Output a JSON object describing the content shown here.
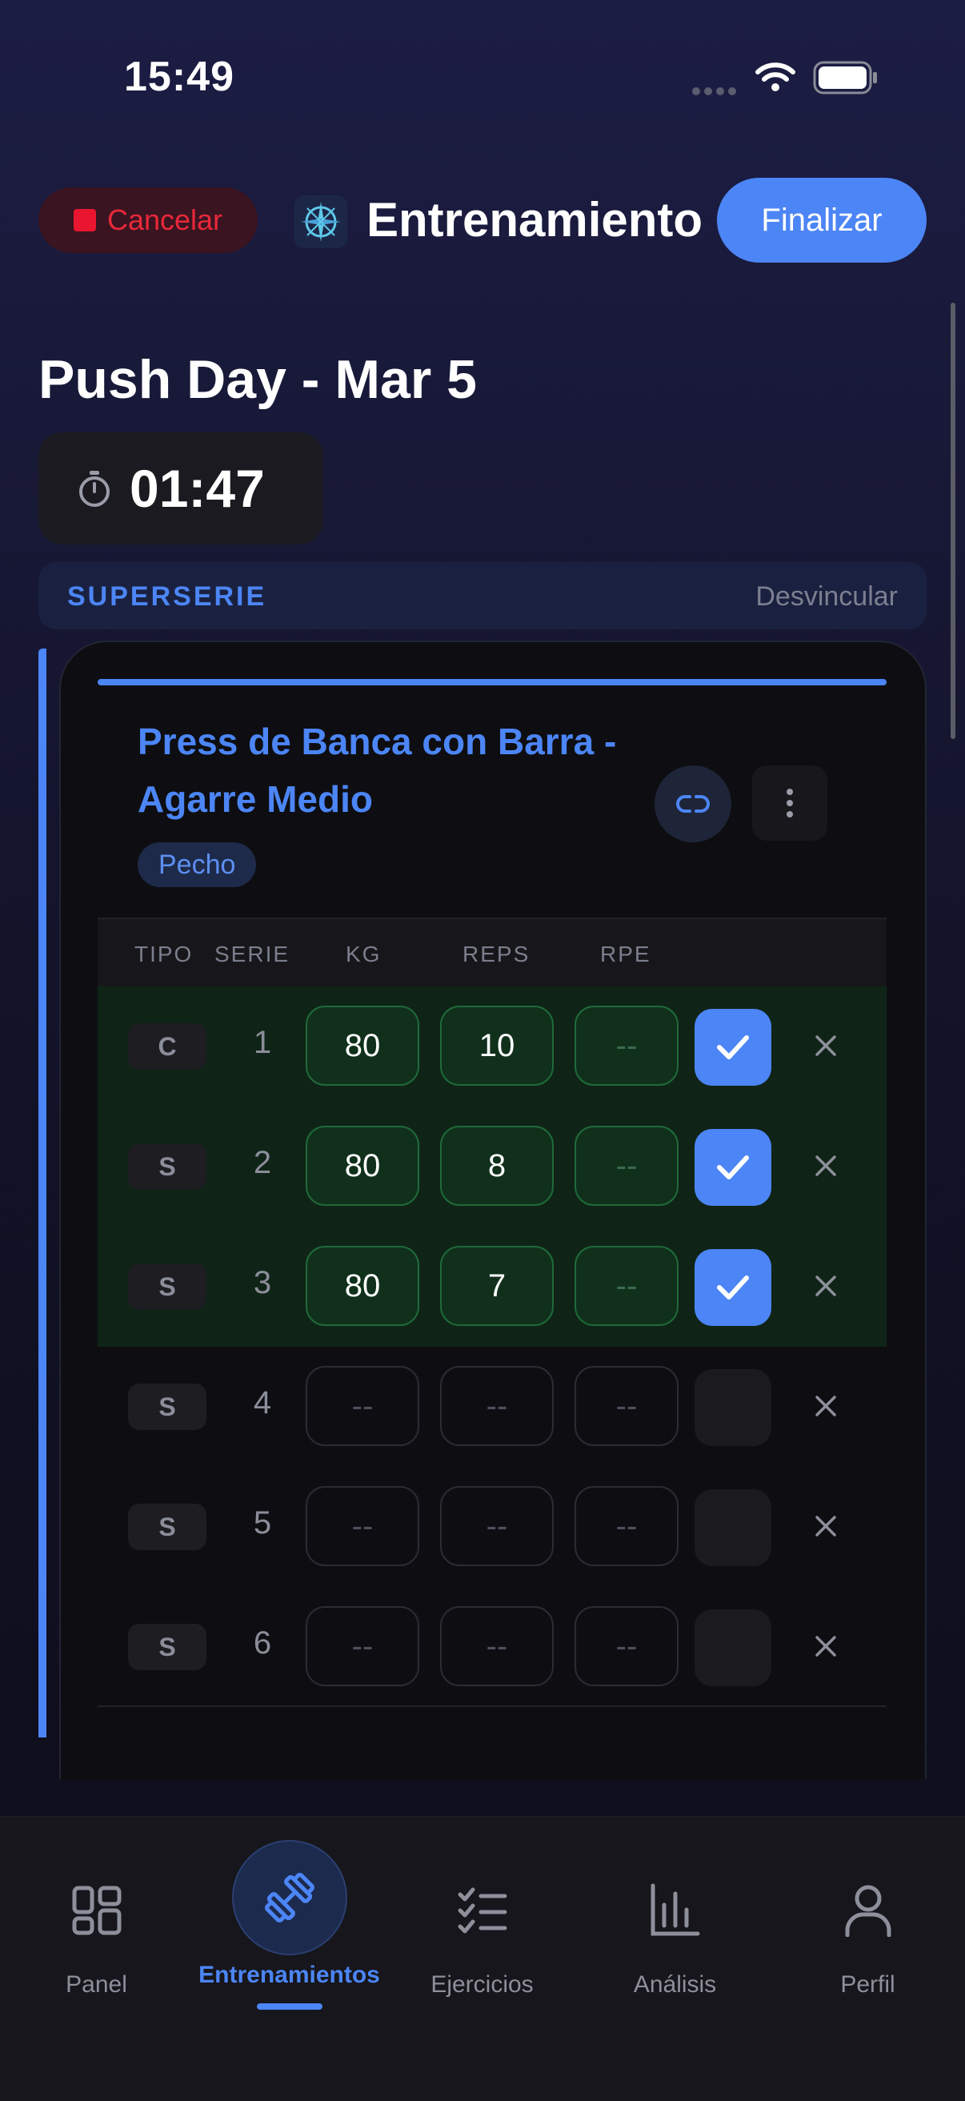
{
  "status_bar": {
    "time": "15:49"
  },
  "header": {
    "cancel_label": "Cancelar",
    "title": "Entrenamiento",
    "finish_label": "Finalizar"
  },
  "workout": {
    "title": "Push Day - Mar 5",
    "timer": "01:47"
  },
  "superset": {
    "label": "SUPERSERIE",
    "unlink_label": "Desvincular"
  },
  "exercise": {
    "name_line1": "Press de Banca con Barra -",
    "name_line2": "Agarre Medio",
    "muscle_tag": "Pecho"
  },
  "table": {
    "headers": {
      "tipo": "TIPO",
      "serie": "SERIE",
      "kg": "KG",
      "reps": "REPS",
      "rpe": "RPE"
    },
    "rows": [
      {
        "type": "C",
        "set": "1",
        "kg": "80",
        "reps": "10",
        "rpe": "--",
        "completed": true
      },
      {
        "type": "S",
        "set": "2",
        "kg": "80",
        "reps": "8",
        "rpe": "--",
        "completed": true
      },
      {
        "type": "S",
        "set": "3",
        "kg": "80",
        "reps": "7",
        "rpe": "--",
        "completed": true
      },
      {
        "type": "S",
        "set": "4",
        "kg": "--",
        "reps": "--",
        "rpe": "--",
        "completed": false
      },
      {
        "type": "S",
        "set": "5",
        "kg": "--",
        "reps": "--",
        "rpe": "--",
        "completed": false
      },
      {
        "type": "S",
        "set": "6",
        "kg": "--",
        "reps": "--",
        "rpe": "--",
        "completed": false
      }
    ]
  },
  "tabs": [
    {
      "label": "Panel",
      "icon": "grid-icon"
    },
    {
      "label": "Entrenamientos",
      "icon": "dumbbell-icon",
      "active": true
    },
    {
      "label": "Ejercicios",
      "icon": "checklist-icon"
    },
    {
      "label": "Análisis",
      "icon": "bar-chart-icon"
    },
    {
      "label": "Perfil",
      "icon": "person-icon"
    }
  ],
  "colors": {
    "accent": "#4c85f5",
    "danger": "#e8162e",
    "done_row": "#0f2417"
  }
}
